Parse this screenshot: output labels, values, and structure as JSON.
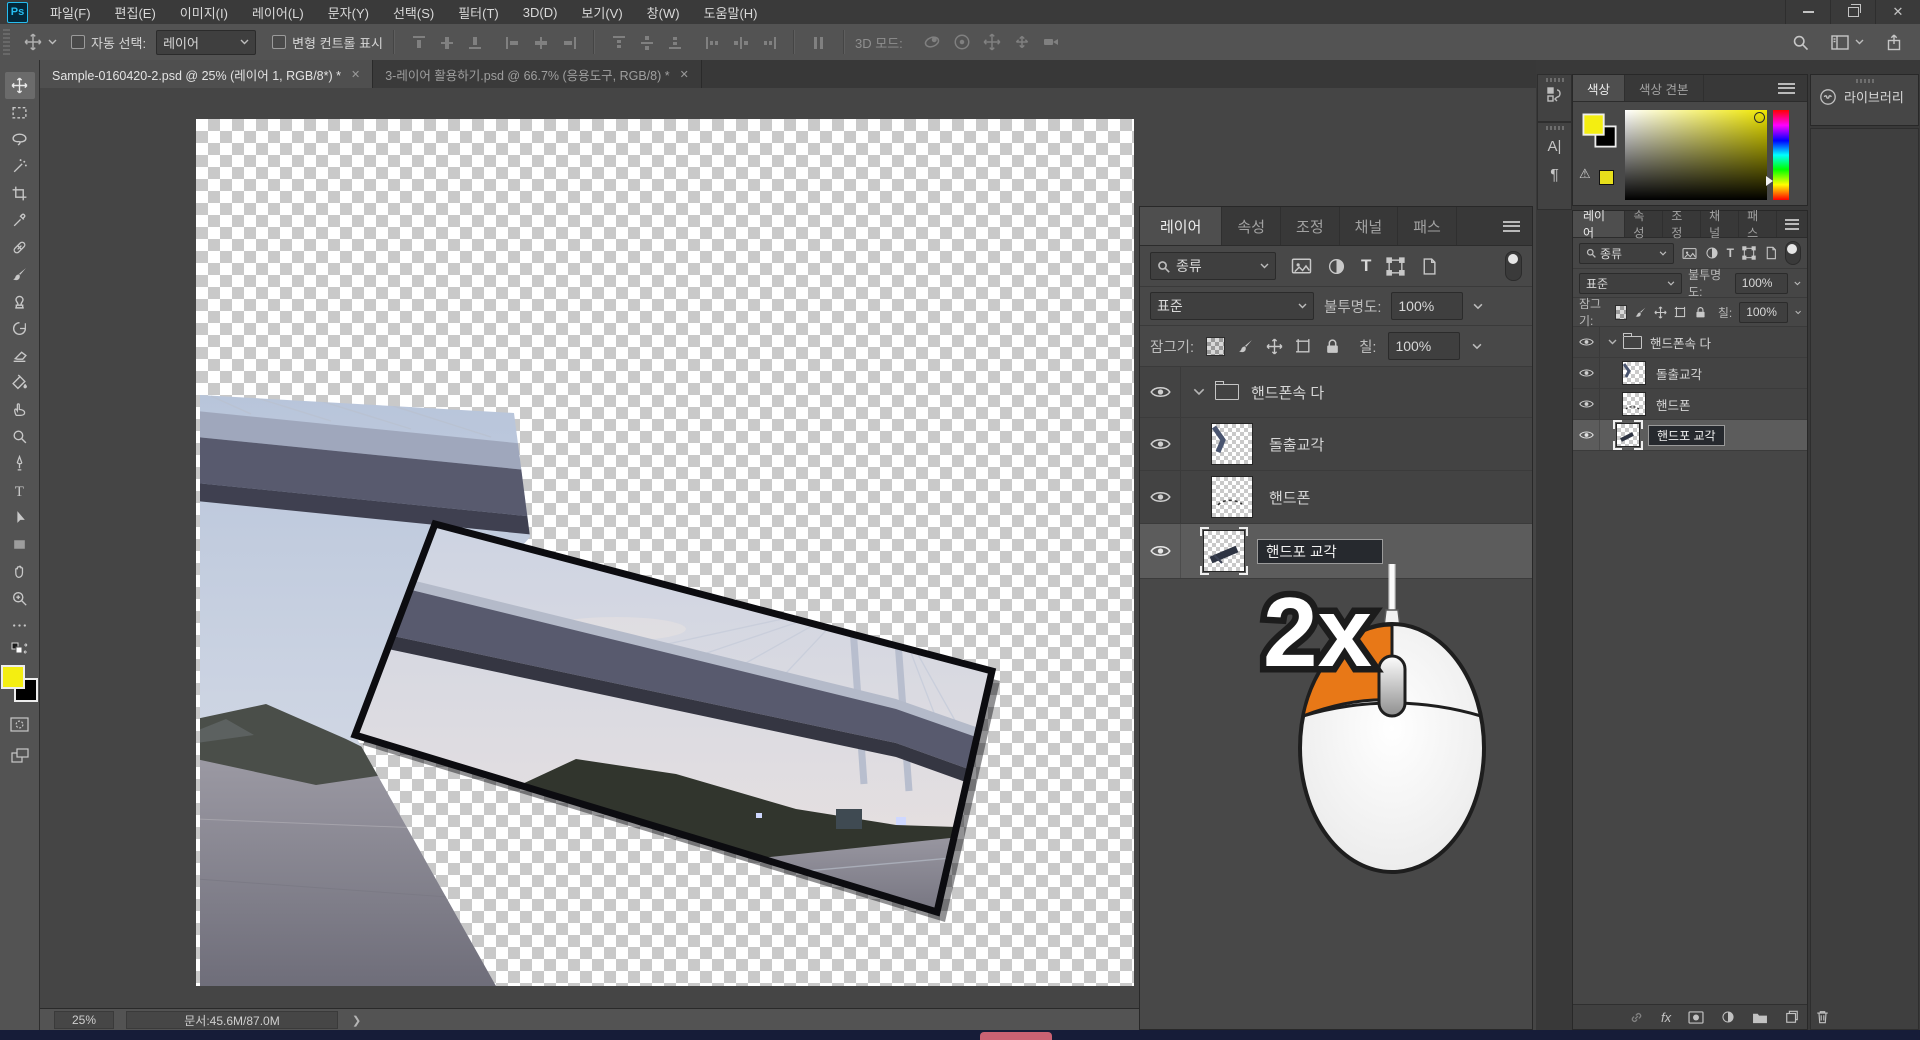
{
  "app": {
    "logo": "Ps"
  },
  "menu": {
    "items": [
      {
        "label": "파일(F)"
      },
      {
        "label": "편집(E)"
      },
      {
        "label": "이미지(I)"
      },
      {
        "label": "레이어(L)"
      },
      {
        "label": "문자(Y)"
      },
      {
        "label": "선택(S)"
      },
      {
        "label": "필터(T)"
      },
      {
        "label": "3D(D)"
      },
      {
        "label": "보기(V)"
      },
      {
        "label": "창(W)"
      },
      {
        "label": "도움말(H)"
      }
    ]
  },
  "options": {
    "auto_select_label": "자동 선택:",
    "auto_select_value": "레이어",
    "show_transform_label": "변형 컨트롤 표시",
    "mode3d_label": "3D 모드:"
  },
  "tabs": [
    {
      "title": "Sample-0160420-2.psd @ 25% (레이어 1, RGB/8*) *"
    },
    {
      "title": "3-레이어 활용하기.psd @ 66.7% (응용도구, RGB/8) *"
    }
  ],
  "panels": {
    "tabs": [
      "레이어",
      "속성",
      "조정",
      "채널",
      "패스"
    ],
    "filter_label": "종류",
    "blend_mode": "표준",
    "opacity_label": "불투명도:",
    "opacity_value": "100%",
    "lock_label": "잠그기:",
    "fill_label": "칠:",
    "fill_value": "100%",
    "rows": [
      {
        "name": "핸드폰속 다",
        "type": "group"
      },
      {
        "name": "돌출교각",
        "type": "layer"
      },
      {
        "name": "핸드폰",
        "type": "layer"
      },
      {
        "name": "핸드포 교각",
        "type": "layer-renaming"
      }
    ]
  },
  "color_panel": {
    "tabs": [
      "색상",
      "색상 견본"
    ],
    "foreground": "#f4ee11",
    "background": "#000000"
  },
  "dock_strip": {
    "char_label": "A|",
    "para_label": "¶"
  },
  "library": {
    "title": "라이브러리"
  },
  "status": {
    "zoom": "25%",
    "doc": "문서:45.6M/87.0M"
  },
  "overlay": {
    "label": "2x",
    "accent": "#e87817"
  },
  "glyphs": {
    "tab_close": "✕",
    "win_close": "✕",
    "status_chevron": "❯",
    "warning": "⚠",
    "fx": "fx"
  }
}
